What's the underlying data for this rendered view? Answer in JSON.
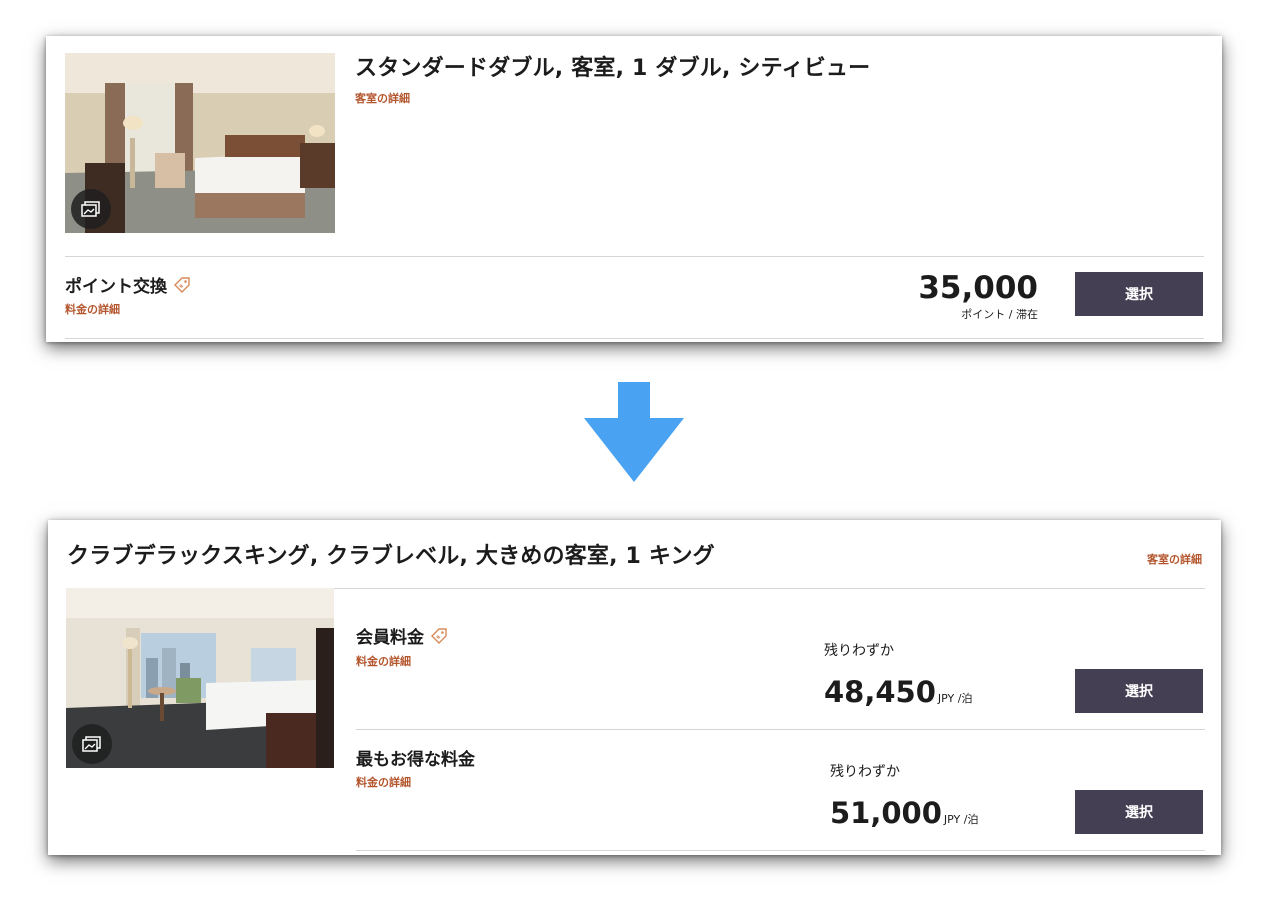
{
  "card1": {
    "room_title": "スタンダードダブル, 客室, 1 ダブル, シティビュー",
    "room_details_link": "客室の詳細",
    "rate": {
      "name": "ポイント交換",
      "details_link": "料金の詳細",
      "price": "35,000",
      "unit": "ポイント / 滞在",
      "select_label": "選択"
    }
  },
  "card2": {
    "room_title": "クラブデラックスキング, クラブレベル, 大きめの客室, 1 キング",
    "room_details_link": "客室の詳細",
    "rates": [
      {
        "name": "会員料金",
        "details_link": "料金の詳細",
        "availability": "残りわずか",
        "price": "48,450",
        "unit": "JPY /泊",
        "select_label": "選択"
      },
      {
        "name": "最もお得な料金",
        "details_link": "料金の詳細",
        "availability": "残りわずか",
        "price": "51,000",
        "unit": "JPY /泊",
        "select_label": "選択"
      }
    ]
  },
  "colors": {
    "link": "#b4562d",
    "button": "#443f52",
    "arrow": "#4aa3f2"
  },
  "icons": {
    "gallery": "gallery-icon",
    "tag": "tag-icon",
    "arrow": "arrow-down-icon"
  }
}
